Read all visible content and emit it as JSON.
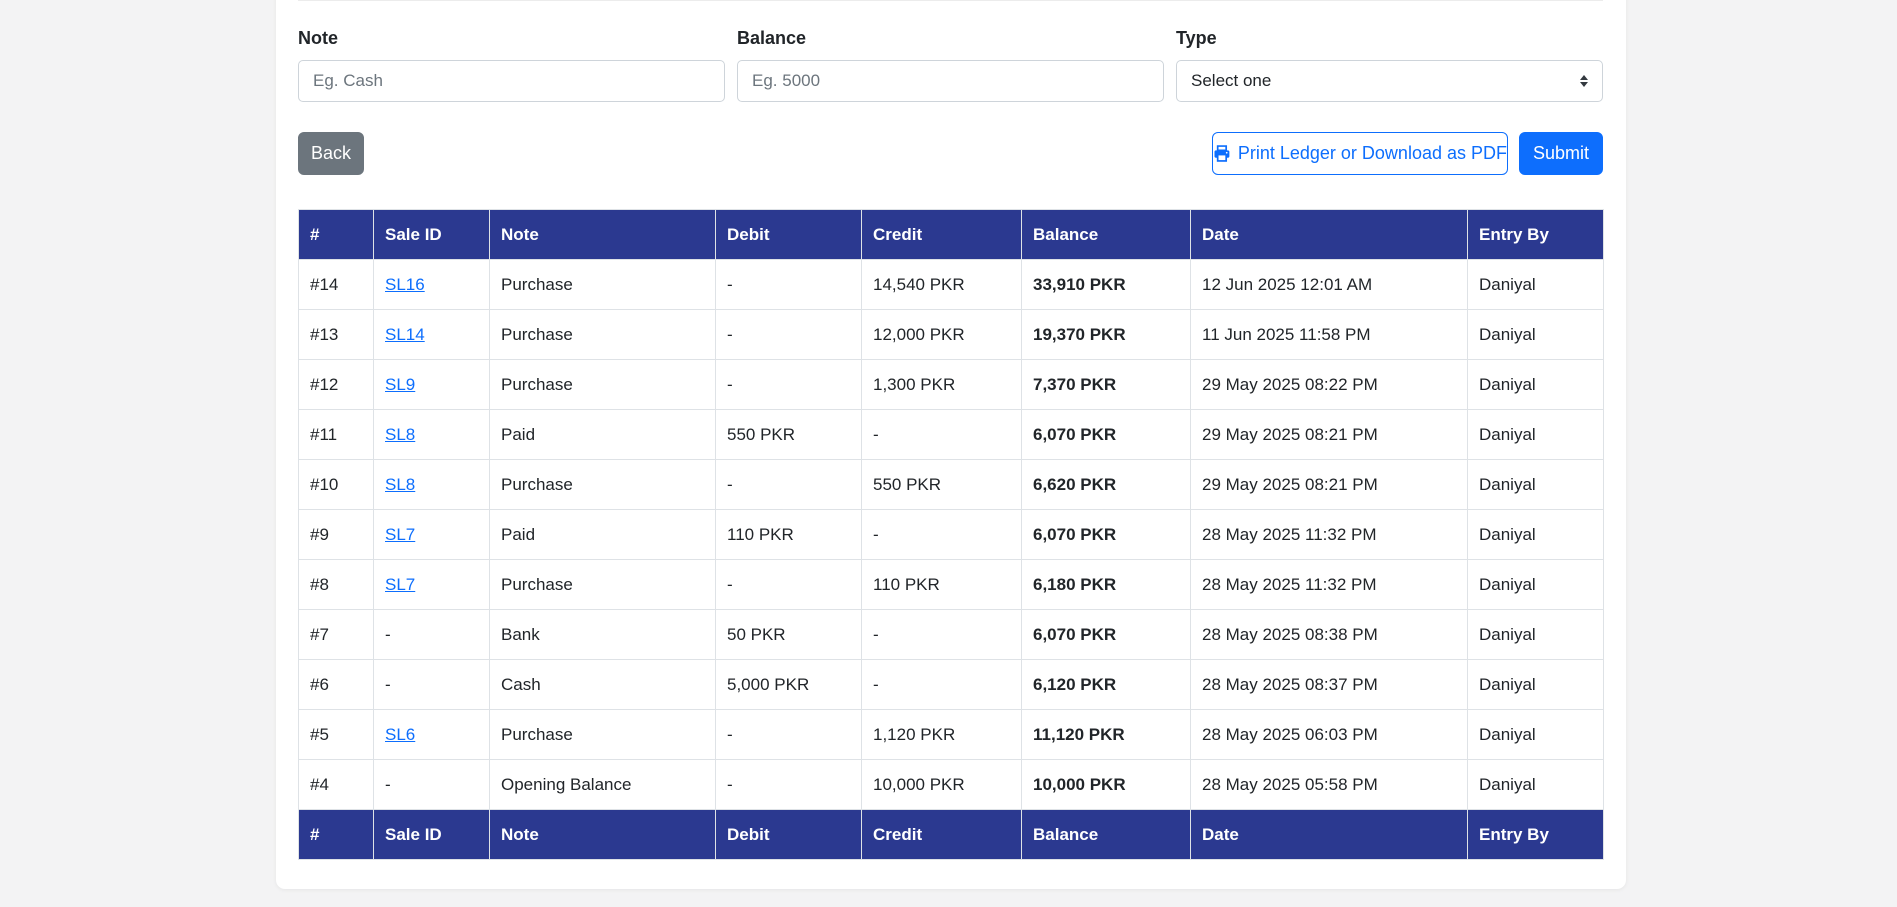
{
  "form": {
    "note": {
      "label": "Note",
      "placeholder": "Eg. Cash",
      "value": ""
    },
    "balance": {
      "label": "Balance",
      "placeholder": "Eg. 5000",
      "value": ""
    },
    "type": {
      "label": "Type",
      "selected": "Select one"
    }
  },
  "buttons": {
    "back": "Back",
    "print": "Print Ledger or Download as PDF",
    "submit": "Submit"
  },
  "colors": {
    "header_bg": "#2b3990",
    "primary": "#0d6efd",
    "secondary": "#6c757d"
  },
  "table": {
    "columns": [
      "#",
      "Sale ID",
      "Note",
      "Debit",
      "Credit",
      "Balance",
      "Date",
      "Entry By"
    ],
    "rows": [
      {
        "num": "#14",
        "sale_id": "SL16",
        "note": "Purchase",
        "debit": "-",
        "credit": "14,540 PKR",
        "balance": "33,910 PKR",
        "date": "12 Jun 2025 12:01 AM",
        "entry_by": "Daniyal"
      },
      {
        "num": "#13",
        "sale_id": "SL14",
        "note": "Purchase",
        "debit": "-",
        "credit": "12,000 PKR",
        "balance": "19,370 PKR",
        "date": "11 Jun 2025 11:58 PM",
        "entry_by": "Daniyal"
      },
      {
        "num": "#12",
        "sale_id": "SL9",
        "note": "Purchase",
        "debit": "-",
        "credit": "1,300 PKR",
        "balance": "7,370 PKR",
        "date": "29 May 2025 08:22 PM",
        "entry_by": "Daniyal"
      },
      {
        "num": "#11",
        "sale_id": "SL8",
        "note": "Paid",
        "debit": "550 PKR",
        "credit": "-",
        "balance": "6,070 PKR",
        "date": "29 May 2025 08:21 PM",
        "entry_by": "Daniyal"
      },
      {
        "num": "#10",
        "sale_id": "SL8",
        "note": "Purchase",
        "debit": "-",
        "credit": "550 PKR",
        "balance": "6,620 PKR",
        "date": "29 May 2025 08:21 PM",
        "entry_by": "Daniyal"
      },
      {
        "num": "#9",
        "sale_id": "SL7",
        "note": "Paid",
        "debit": "110 PKR",
        "credit": "-",
        "balance": "6,070 PKR",
        "date": "28 May 2025 11:32 PM",
        "entry_by": "Daniyal"
      },
      {
        "num": "#8",
        "sale_id": "SL7",
        "note": "Purchase",
        "debit": "-",
        "credit": "110 PKR",
        "balance": "6,180 PKR",
        "date": "28 May 2025 11:32 PM",
        "entry_by": "Daniyal"
      },
      {
        "num": "#7",
        "sale_id": "-",
        "note": "Bank",
        "debit": "50 PKR",
        "credit": "-",
        "balance": "6,070 PKR",
        "date": "28 May 2025 08:38 PM",
        "entry_by": "Daniyal"
      },
      {
        "num": "#6",
        "sale_id": "-",
        "note": "Cash",
        "debit": "5,000 PKR",
        "credit": "-",
        "balance": "6,120 PKR",
        "date": "28 May 2025 08:37 PM",
        "entry_by": "Daniyal"
      },
      {
        "num": "#5",
        "sale_id": "SL6",
        "note": "Purchase",
        "debit": "-",
        "credit": "1,120 PKR",
        "balance": "11,120 PKR",
        "date": "28 May 2025 06:03 PM",
        "entry_by": "Daniyal"
      },
      {
        "num": "#4",
        "sale_id": "-",
        "note": "Opening Balance",
        "debit": "-",
        "credit": "10,000 PKR",
        "balance": "10,000 PKR",
        "date": "28 May 2025 05:58 PM",
        "entry_by": "Daniyal"
      }
    ]
  }
}
